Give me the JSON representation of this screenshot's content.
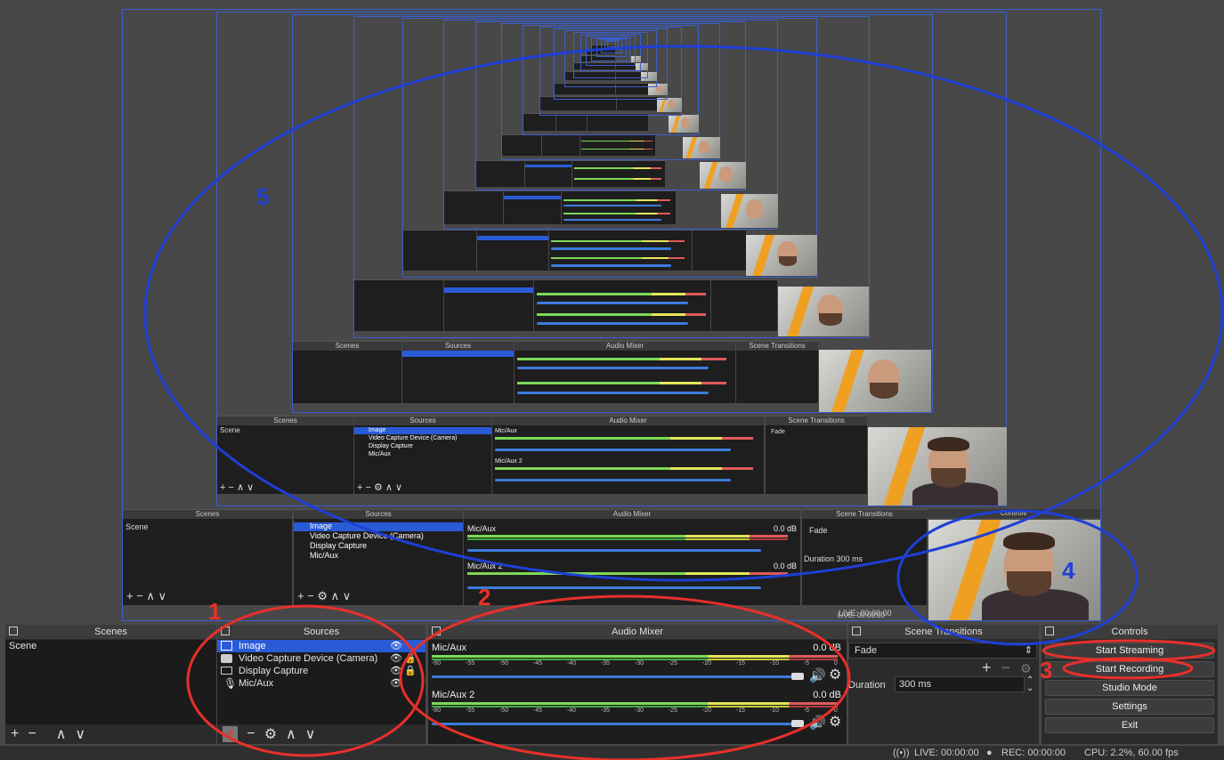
{
  "docks": {
    "scenes": {
      "title": "Scenes",
      "items": [
        "Scene"
      ],
      "toolbar": [
        "+",
        "−",
        "∧",
        "∨"
      ]
    },
    "sources": {
      "title": "Sources",
      "items": [
        {
          "label": "Image",
          "icon": "image-icon",
          "selected": true
        },
        {
          "label": "Video Capture Device (Camera)",
          "icon": "camera-icon",
          "selected": false
        },
        {
          "label": "Display Capture",
          "icon": "monitor-icon",
          "selected": false
        },
        {
          "label": "Mic/Aux",
          "icon": "microphone-icon",
          "selected": false
        }
      ],
      "toolbar": [
        "+",
        "−",
        "⚙",
        "∧",
        "∨"
      ]
    },
    "mixer": {
      "title": "Audio Mixer",
      "channels": [
        {
          "name": "Mic/Aux",
          "db": "0.0 dB"
        },
        {
          "name": "Mic/Aux 2",
          "db": "0.0 dB"
        }
      ],
      "ticks": [
        "-60",
        "-55",
        "-50",
        "-45",
        "-40",
        "-35",
        "-30",
        "-25",
        "-20",
        "-15",
        "-10",
        "-5",
        "0"
      ]
    },
    "transitions": {
      "title": "Scene Transitions",
      "selected": "Fade",
      "duration_label": "Duration",
      "duration_value": "300 ms"
    },
    "controls": {
      "title": "Controls",
      "buttons": [
        "Start Streaming",
        "Start Recording",
        "Studio Mode",
        "Settings",
        "Exit"
      ]
    }
  },
  "status": {
    "live": "LIVE: 00:00:00",
    "rec": "REC: 00:00:00",
    "cpu": "CPU: 2.2%, 60.00 fps"
  },
  "annotations": {
    "labels": [
      "1",
      "2",
      "3",
      "4",
      "5"
    ],
    "colors": {
      "red": "#e8302a",
      "blue": "#1f3fd6"
    }
  },
  "preview": {
    "mini_headers": [
      "Scenes",
      "Sources",
      "Audio Mixer",
      "Scene Transitions",
      "Controls"
    ],
    "mini_scene": "Scene",
    "mini_sources": [
      "Image",
      "Video Capture Device (Camera)",
      "Display Capture",
      "Mic/Aux"
    ],
    "mini_channels": [
      "Mic/Aux",
      "Mic/Aux 2"
    ],
    "mini_db": "0.0 dB",
    "mini_fade": "Fade",
    "mini_duration": "Duration",
    "mini_duration_value": "300 ms",
    "mini_live": "LIVE: 00:00:00"
  }
}
